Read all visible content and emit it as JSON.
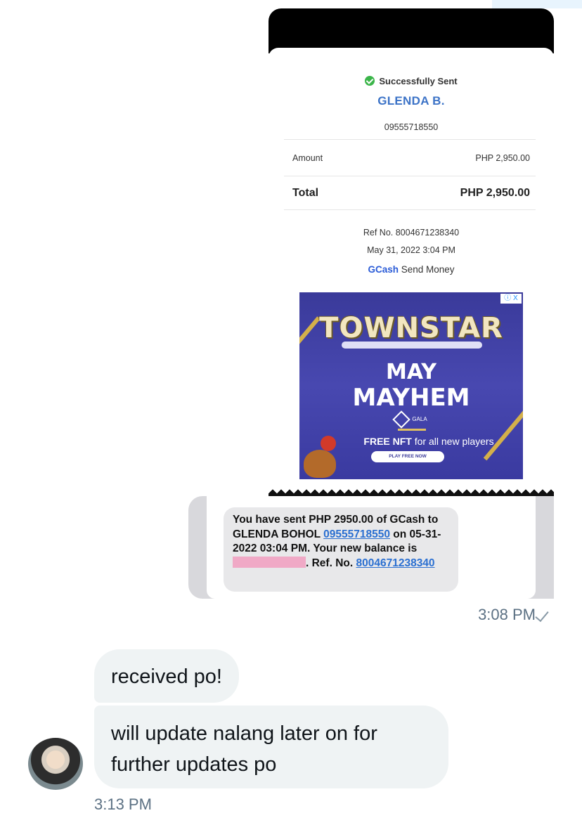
{
  "receipt": {
    "status": "Successfully Sent",
    "recipient_name": "GLENDA B.",
    "recipient_number": "09555718550",
    "amount_label": "Amount",
    "amount_value": "PHP 2,950.00",
    "total_label": "Total",
    "total_value": "PHP 2,950.00",
    "ref_no": "Ref No. 8004671238340",
    "datetime": "May 31, 2022 3:04 PM",
    "brand": "GCash",
    "service": "Send Money"
  },
  "ad": {
    "logo": "TOWNSTAR",
    "headline_1": "MAY",
    "headline_2": "MAYHEM",
    "sponsor": "GALA",
    "free_bold": "FREE NFT",
    "free_rest": "for all new players",
    "cta": "PLAY FREE NOW",
    "close": "ⓘ X"
  },
  "sms": {
    "line_start": "You have sent PHP 2950.00 of GCash to GLENDA BOHOL ",
    "number_link": "09555718550",
    "line_mid": " on 05-31-2022 03:04 PM. Your new balance is ",
    "line_after_redact": ". Ref. No. ",
    "ref_link": "8004671238340"
  },
  "messages": {
    "sent_time": "3:08 PM",
    "received_1": "received po!",
    "received_2": "will update nalang later on for further updates po",
    "received_time": "3:13 PM"
  }
}
